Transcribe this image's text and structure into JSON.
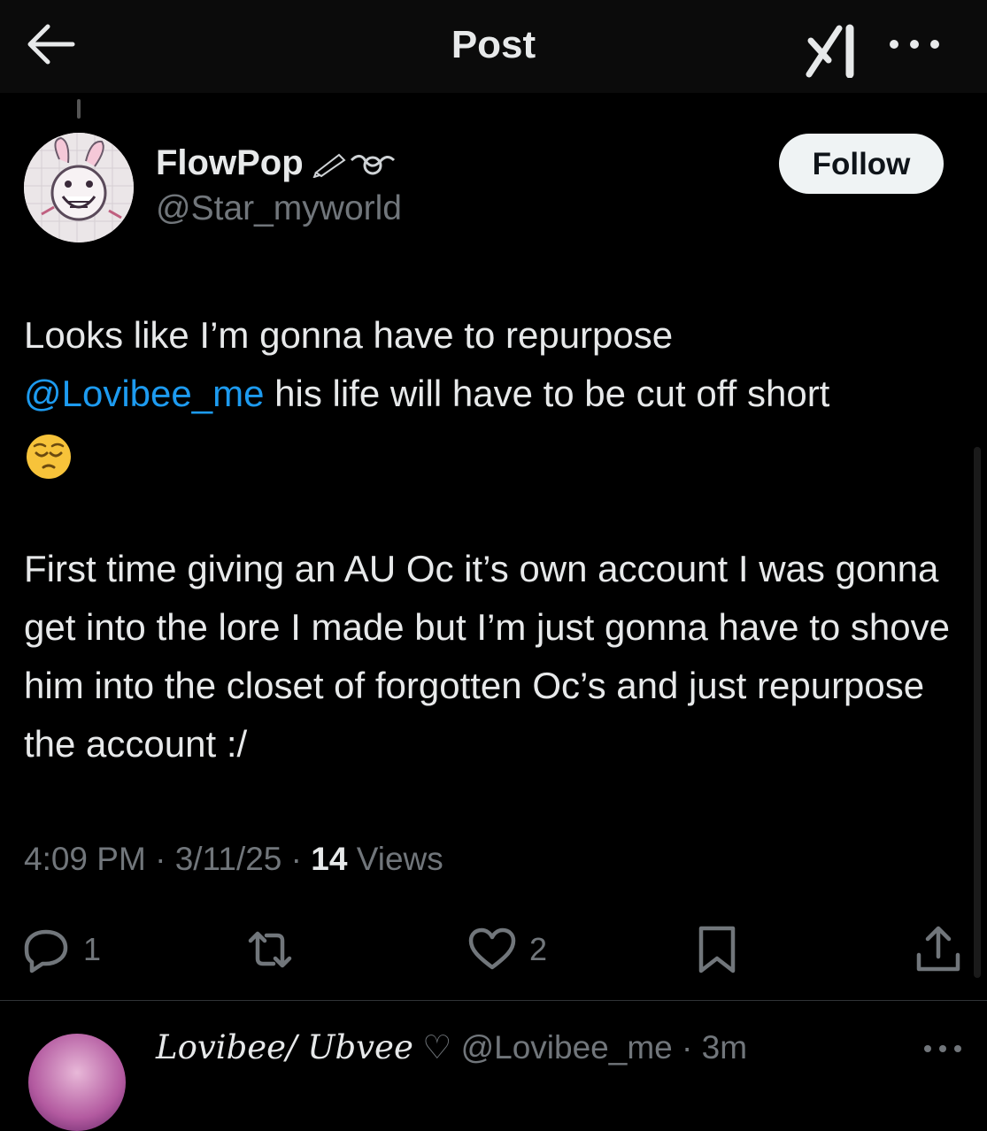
{
  "header": {
    "title": "Post",
    "back_icon": "arrow-left-icon",
    "grok_icon": "grok-icon",
    "more_icon": "more-horizontal-icon"
  },
  "author": {
    "name": "FlowPop",
    "handle": "@Star_myworld",
    "name_emojis": "✏️➰",
    "follow_label": "Follow"
  },
  "post": {
    "line1": "Looks like I’m gonna have to repurpose",
    "mention": "@Lovibee_me",
    "line2_rest": " his life will have to be cut off short",
    "emoji": "😔",
    "para2": "First time giving an AU Oc it’s own account I was gonna get into the lore I made but I’m just gonna have to shove him into the closet of forgotten Oc’s and just repurpose the account :/"
  },
  "meta": {
    "time": "4:09 PM",
    "sep1": " · ",
    "date": "3/11/25",
    "sep2": " · ",
    "views_count": "14",
    "views_label": " Views"
  },
  "actions": {
    "replies": "1",
    "likes": "2"
  },
  "reply": {
    "name": "Lovibee/ Ubvee",
    "heart": "♡",
    "handle": "@Lovibee_me",
    "sep": " · ",
    "time": "3m"
  },
  "colors": {
    "background": "#000000",
    "text": "#e7e9ea",
    "muted": "#71767b",
    "link": "#1d9bf0"
  }
}
